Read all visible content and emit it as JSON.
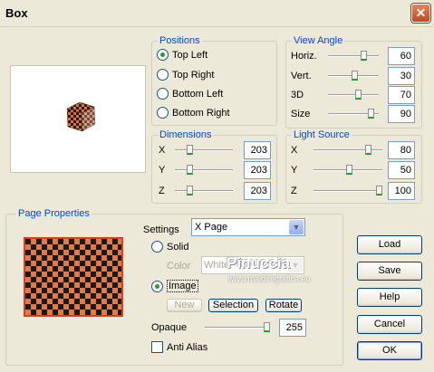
{
  "window": {
    "title": "Box",
    "close_icon": "close-icon"
  },
  "positions": {
    "legend": "Positions",
    "options": [
      {
        "label": "Top Left",
        "selected": true
      },
      {
        "label": "Top Right",
        "selected": false
      },
      {
        "label": "Bottom Left",
        "selected": false
      },
      {
        "label": "Bottom Right",
        "selected": false
      }
    ]
  },
  "view_angle": {
    "legend": "View Angle",
    "rows": [
      {
        "label": "Horiz.",
        "value": "60"
      },
      {
        "label": "Vert.",
        "value": "30"
      },
      {
        "label": "3D",
        "value": "70"
      },
      {
        "label": "Size",
        "value": "90"
      }
    ]
  },
  "dimensions": {
    "legend": "Dimensions",
    "rows": [
      {
        "label": "X",
        "value": "203"
      },
      {
        "label": "Y",
        "value": "203"
      },
      {
        "label": "Z",
        "value": "203"
      }
    ]
  },
  "light_source": {
    "legend": "Light Source",
    "rows": [
      {
        "label": "X",
        "value": "80"
      },
      {
        "label": "Y",
        "value": "50"
      },
      {
        "label": "Z",
        "value": "100"
      }
    ]
  },
  "page_properties": {
    "legend": "Page Properties",
    "settings_label": "Settings",
    "settings_value": "X Page",
    "solid_label": "Solid",
    "color_label": "Color",
    "color_value": "White",
    "image_label": "Image",
    "new_label": "New",
    "selection_label": "Selection",
    "rotate_label": "Rotate",
    "opaque_label": "Opaque",
    "opaque_value": "255",
    "anti_alias_label": "Anti Alias",
    "image_selected": true,
    "anti_alias_checked": false
  },
  "buttons": {
    "load": "Load",
    "save": "Save",
    "help": "Help",
    "cancel": "Cancel",
    "ok": "OK"
  },
  "watermark": {
    "text": "Pinuccia",
    "url": "www.maidiregrafica.eu"
  }
}
